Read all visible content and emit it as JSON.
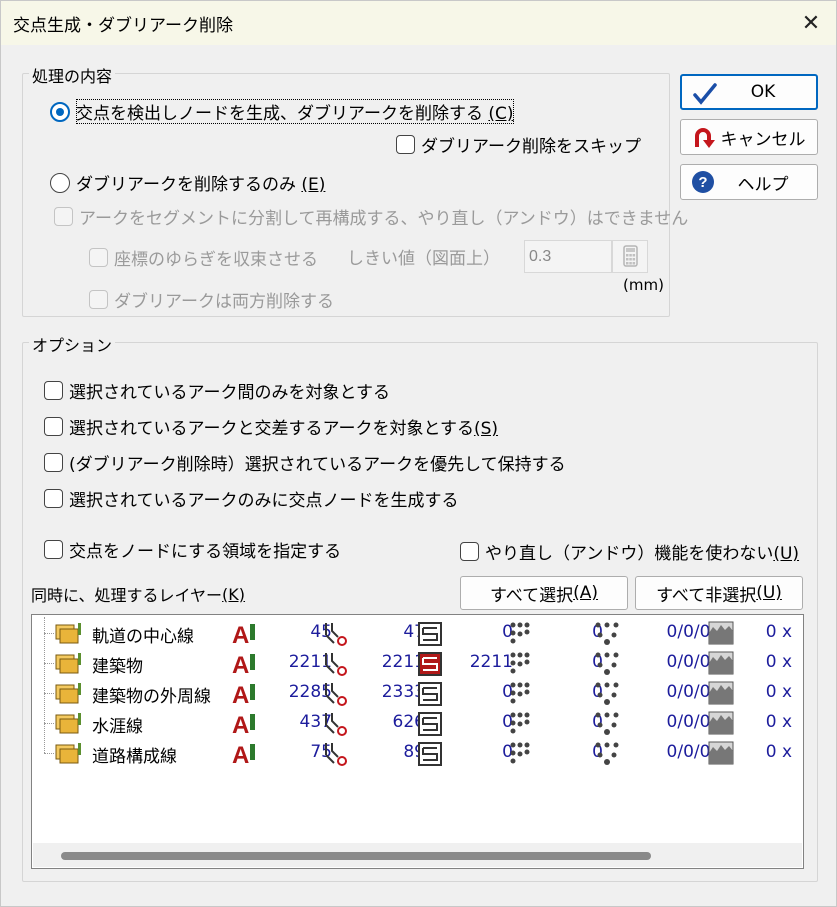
{
  "window": {
    "title": "交点生成・ダブリアーク削除",
    "close_label": "✕"
  },
  "processing_group": {
    "legend": "処理の内容",
    "radio1_label": "交点を検出しノードを生成、ダブリアークを削除する",
    "radio1_key": "(C)",
    "skip_label": "ダブリアーク削除をスキップ",
    "radio2_label": "ダブリアークを削除するのみ",
    "radio2_key": "(E)",
    "segment_label": "アークをセグメントに分割して再構成する、やり直し（アンドウ）はできません",
    "converge_label": "座標のゆらぎを収束させる",
    "threshold_label": "しきい値（図面上）",
    "threshold_value": "0.3",
    "unit_label": "(mm)",
    "both_delete_label": "ダブリアークは両方削除する"
  },
  "buttons": {
    "ok": "OK",
    "cancel": "キャンセル",
    "help": "ヘルプ"
  },
  "options_group": {
    "legend": "オプション",
    "opt1": "選択されているアーク間のみを対象とする",
    "opt2": "選択されているアークと交差するアークを対象とする",
    "opt2_key": "(S)",
    "opt3": "(ダブリアーク削除時）選択されているアークを優先して保持する",
    "opt4": "選択されているアークのみに交点ノードを生成する",
    "opt5": "交点をノードにする領域を指定する",
    "opt6": "やり直し（アンドウ）機能を使わない",
    "opt6_key": "(U)",
    "layers_label": "同時に、処理するレイヤー",
    "layers_key": "(K)",
    "select_all": "すべて選択",
    "select_all_key": "(A)",
    "deselect_all": "すべて非選択",
    "deselect_all_key": "(U)"
  },
  "layers": [
    {
      "name": "軌道の中心線",
      "arcs": "45",
      "nodes": "47",
      "polygons": "0",
      "points": "0",
      "ratio": "0/0/0/0",
      "mesh": "0 x",
      "poly_active": false
    },
    {
      "name": "建築物",
      "arcs": "2211",
      "nodes": "2211",
      "polygons": "2211",
      "points": "0",
      "ratio": "0/0/0/0",
      "mesh": "0 x",
      "poly_active": true
    },
    {
      "name": "建築物の外周線",
      "arcs": "2285",
      "nodes": "2333",
      "polygons": "0",
      "points": "0",
      "ratio": "0/0/0/0",
      "mesh": "0 x",
      "poly_active": false
    },
    {
      "name": "水涯線",
      "arcs": "437",
      "nodes": "626",
      "polygons": "0",
      "points": "0",
      "ratio": "0/0/0/0",
      "mesh": "0 x",
      "poly_active": false
    },
    {
      "name": "道路構成線",
      "arcs": "75",
      "nodes": "89",
      "polygons": "0",
      "points": "0",
      "ratio": "0/0/0/0",
      "mesh": "0 x",
      "poly_active": false
    }
  ],
  "colors": {
    "accent": "#0067c0",
    "number": "#1c1c9c",
    "arc_icon": "#b01818"
  }
}
